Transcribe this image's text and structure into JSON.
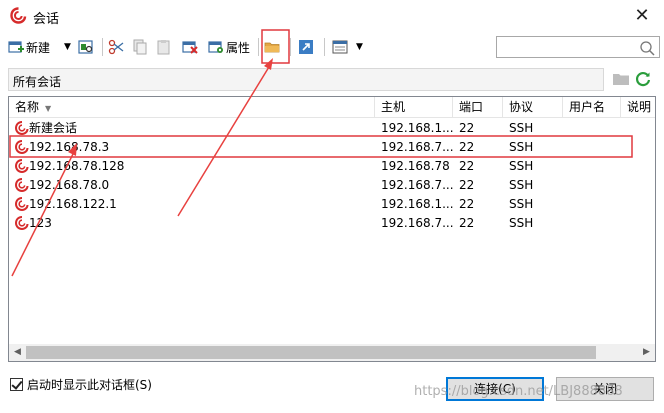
{
  "window": {
    "title": "会话",
    "close_glyph": "✕"
  },
  "toolbar": {
    "new_label": "新建",
    "properties_label": "属性"
  },
  "search": {
    "value": "",
    "placeholder": ""
  },
  "path": {
    "label": "所有会话"
  },
  "columns": {
    "name": "名称",
    "host": "主机",
    "port": "端口",
    "protocol": "协议",
    "username": "用户名",
    "description": "说明"
  },
  "sessions": [
    {
      "name": "新建会话",
      "host": "192.168.1...",
      "port": "22",
      "protocol": "SSH"
    },
    {
      "name": "192.168.78.3",
      "host": "192.168.7...",
      "port": "22",
      "protocol": "SSH"
    },
    {
      "name": "192.168.78.128",
      "host": "192.168.78",
      "port": "22",
      "protocol": "SSH"
    },
    {
      "name": "192.168.78.0",
      "host": "192.168.7...",
      "port": "22",
      "protocol": "SSH"
    },
    {
      "name": "192.168.122.1",
      "host": "192.168.1...",
      "port": "22",
      "protocol": "SSH"
    },
    {
      "name": "123",
      "host": "192.168.7...",
      "port": "22",
      "protocol": "SSH"
    }
  ],
  "footer": {
    "startup_label": "启动时显示此对话框(S)",
    "startup_checked": true,
    "connect_label": "连接(C)",
    "close_label": "关闭"
  },
  "watermark": "https://blog.csdn.net/LBJ888888",
  "colors": {
    "highlight_box": "#e0393e",
    "arrow": "#e8413f",
    "accent": "#0078d7"
  }
}
